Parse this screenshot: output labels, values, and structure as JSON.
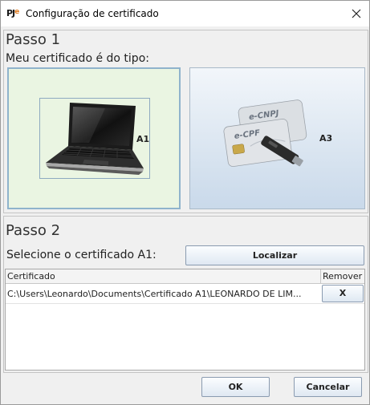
{
  "window": {
    "title": "Configuração de certificado",
    "app_icon_text": "PJ",
    "app_icon_accent": "e"
  },
  "step1": {
    "heading": "Passo 1",
    "prompt": "Meu certificado é do tipo:",
    "options": [
      {
        "label": "A1",
        "selected": true
      },
      {
        "label": "A3",
        "selected": false
      }
    ],
    "card_texts": [
      "e-CNPJ",
      "e-CPF"
    ]
  },
  "step2": {
    "heading": "Passo 2",
    "select_label": "Selecione o certificado A1:",
    "locate_button": "Localizar"
  },
  "table": {
    "columns": [
      "Certificado",
      "Remover"
    ],
    "rows": [
      {
        "path": "C:\\Users\\Leonardo\\Documents\\Certificado A1\\LEONARDO DE LIM...",
        "remove": "X"
      }
    ]
  },
  "footer": {
    "ok": "OK",
    "cancel": "Cancelar"
  },
  "colors": {
    "selected_background": "#eaf5e2",
    "button_gradient_top": "#fbfdff",
    "button_gradient_bottom": "#dfe8f2"
  }
}
